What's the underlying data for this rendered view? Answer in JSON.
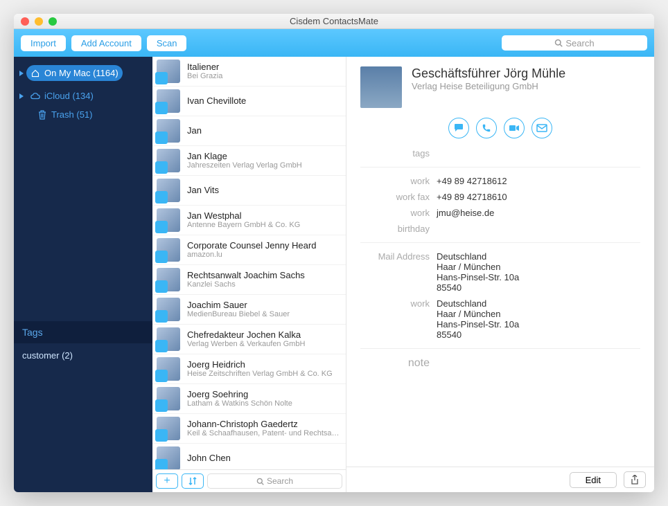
{
  "window": {
    "title": "Cisdem ContactsMate"
  },
  "toolbar": {
    "import": "Import",
    "add_account": "Add Account",
    "scan": "Scan",
    "search_placeholder": "Search"
  },
  "sidebar": {
    "accounts": [
      {
        "label": "On My Mac (1164)",
        "selected": true,
        "icon": "home"
      },
      {
        "label": "iCloud (134)",
        "selected": false,
        "icon": "cloud"
      }
    ],
    "trash": "Trash (51)",
    "tags_header": "Tags",
    "tags": [
      {
        "label": "customer (2)"
      }
    ]
  },
  "contacts": [
    {
      "name": "Italiener",
      "sub": "Bei Grazia"
    },
    {
      "name": "Ivan Chevillote",
      "sub": ""
    },
    {
      "name": "Jan",
      "sub": ""
    },
    {
      "name": "Jan Klage",
      "sub": "Jahreszeiten Verlag Verlag GmbH"
    },
    {
      "name": "Jan Vits",
      "sub": ""
    },
    {
      "name": "Jan Westphal",
      "sub": "Antenne Bayern GmbH & Co. KG"
    },
    {
      "name": "Corporate Counsel Jenny Heard",
      "sub": "amazon.lu"
    },
    {
      "name": "Rechtsanwalt Joachim Sachs",
      "sub": "Kanzlei Sachs"
    },
    {
      "name": "Joachim Sauer",
      "sub": "MedienBureau Biebel & Sauer"
    },
    {
      "name": "Chefredakteur Jochen Kalka",
      "sub": "Verlag Werben & Verkaufen GmbH"
    },
    {
      "name": "Joerg Heidrich",
      "sub": "Heise Zeitschriften Verlag GmbH & Co. KG"
    },
    {
      "name": "Joerg Soehring",
      "sub": "Latham & Watkins Schön Nolte"
    },
    {
      "name": "Johann-Christoph Gaedertz",
      "sub": "Keil & Schaafhausen, Patent- und Rechtsa…"
    },
    {
      "name": "John Chen",
      "sub": ""
    }
  ],
  "list_footer": {
    "search_placeholder": "Search"
  },
  "detail": {
    "title": "Geschäftsführer Jörg Mühle",
    "subtitle": "Verlag Heise Beteiligung GmbH",
    "rows": [
      {
        "label": "tags",
        "value": ""
      },
      {
        "label": "work",
        "value": "+49 89 42718612"
      },
      {
        "label": "work fax",
        "value": "+49 89 42718610"
      },
      {
        "label": "work",
        "value": "jmu@heise.de"
      },
      {
        "label": "birthday",
        "value": ""
      },
      {
        "label": "Mail Address",
        "value": "Deutschland\nHaar / München\nHans-Pinsel-Str. 10a\n85540"
      },
      {
        "label": "work",
        "value": "Deutschland\nHaar / München\nHans-Pinsel-Str. 10a\n85540"
      }
    ],
    "note_label": "note",
    "edit": "Edit"
  }
}
